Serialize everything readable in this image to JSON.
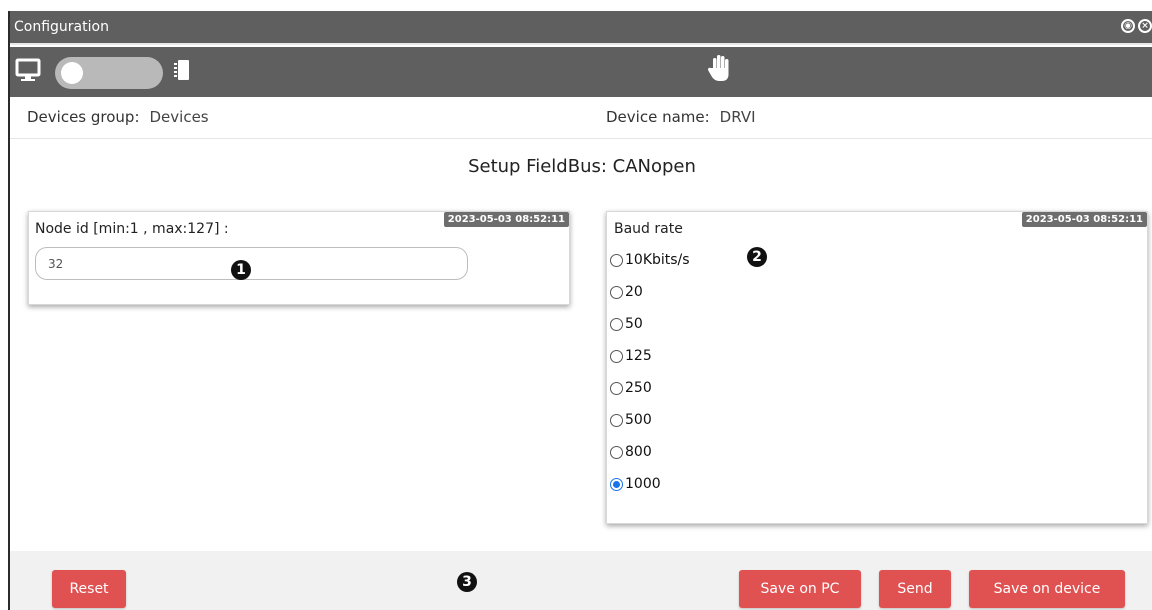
{
  "window": {
    "title": "Configuration",
    "controls": [
      "pin-icon",
      "close-icon"
    ]
  },
  "toolbar": {
    "icons": [
      "monitor-icon",
      "chip-icon",
      "hand-icon"
    ],
    "mode_toggle_state": "pc"
  },
  "info": {
    "group_label": "Devices group:",
    "group_value": "Devices",
    "device_label": "Device name:",
    "device_value": "DRVI"
  },
  "setup_title": "Setup FieldBus: CANopen",
  "node_card": {
    "timestamp": "2023-05-03 08:52:11",
    "label": "Node id [min:1 , max:127] :",
    "value": "32"
  },
  "baud_card": {
    "timestamp": "2023-05-03 08:52:11",
    "label": "Baud rate",
    "options": [
      "10Kbits/s",
      "20",
      "50",
      "125",
      "250",
      "500",
      "800",
      "1000"
    ],
    "selected": "1000"
  },
  "markers": [
    "1",
    "2",
    "3"
  ],
  "buttons": {
    "reset": "Reset",
    "save_pc": "Save on PC",
    "send": "Send",
    "save_device": "Save on device"
  },
  "colors": {
    "titlebar": "#5f5f5f",
    "button": "#e05252",
    "radio_selected": "#1a73e8"
  }
}
